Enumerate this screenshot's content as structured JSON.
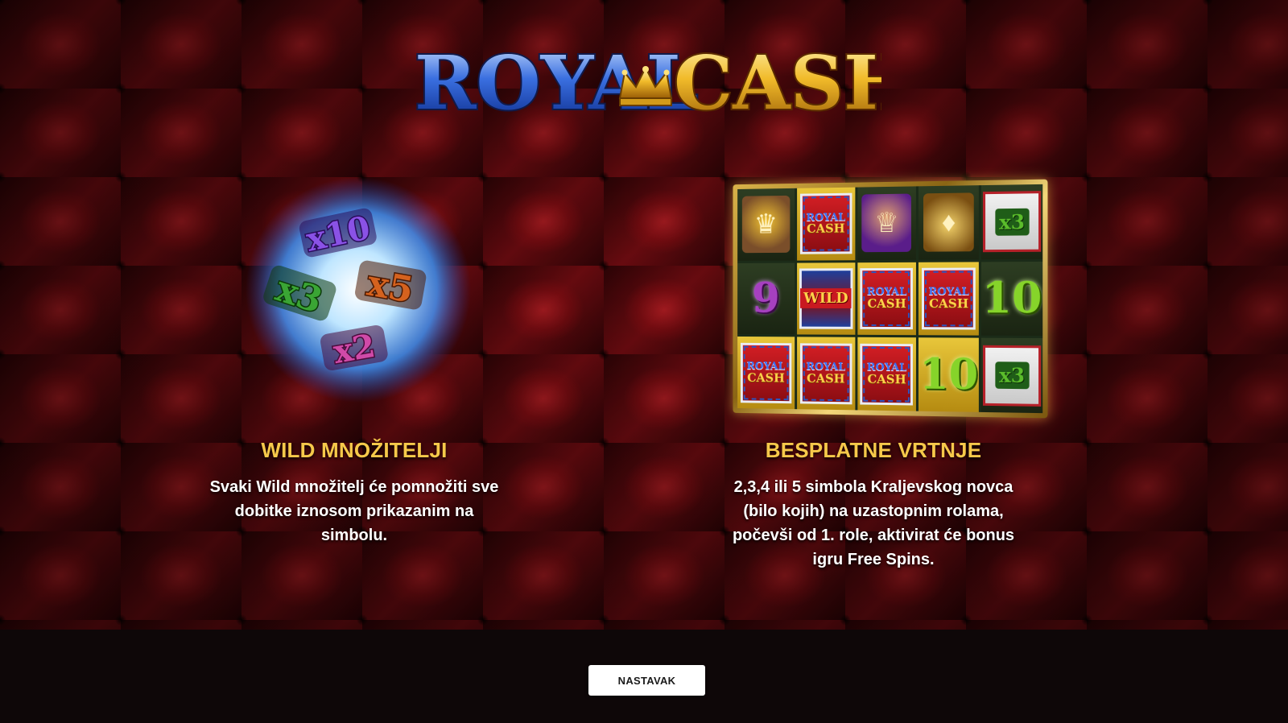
{
  "game": {
    "logo": {
      "word1": "ROYAL",
      "word2": "CASH",
      "icon": "crown-icon"
    }
  },
  "features": {
    "left": {
      "title": "WILD MNOŽITELJI",
      "desc": "Svaki Wild množitelj će pomnožiti sve dobitke iznosom prikazanim na simbolu.",
      "multipliers": [
        "x10",
        "x3",
        "x5",
        "x2"
      ],
      "multiplier_colors": [
        "#7a3fd0",
        "#2f8a2a",
        "#c8531a",
        "#c0389a"
      ]
    },
    "right": {
      "title": "BESPLATNE VRTNJE",
      "desc": "2,3,4 ili 5 simbola Kraljevskog novca (bilo kojih) na uzastopnim rolama, počevši od 1. role, aktivirat će bonus igru Free Spins.",
      "reels": {
        "cash_line1": "ROYAL",
        "cash_line2": "CASH",
        "wild_label": "WILD",
        "mult_label": "x3",
        "num9": "9",
        "num10": "10"
      }
    }
  },
  "footer": {
    "continue_label": "NASTAVAK"
  },
  "colors": {
    "title_gold": "#f6c94a",
    "background_red": "#4a0709",
    "button_bg": "#ffffff"
  }
}
